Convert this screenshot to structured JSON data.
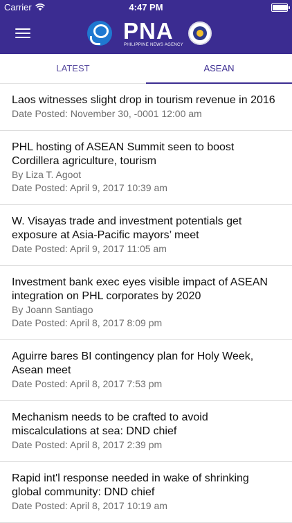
{
  "status_bar": {
    "carrier": "Carrier",
    "time": "4:47 PM",
    "battery_level": 1.0
  },
  "header": {
    "menu_icon": "hamburger-menu-icon",
    "logo_text": "PNA",
    "logo_subtitle": "PHILIPPINE NEWS AGENCY",
    "colors": {
      "primary": "#3b2c91",
      "logo_blue": "#1f78d1"
    }
  },
  "tabs": [
    {
      "label": "LATEST",
      "active": false
    },
    {
      "label": "ASEAN",
      "active": true
    }
  ],
  "articles": [
    {
      "title": "Laos witnesses slight drop in tourism revenue in 2016",
      "author": "",
      "date": "Date Posted: November 30, -0001 12:00 am"
    },
    {
      "title": "PHL hosting of ASEAN Summit seen to boost Cordillera agriculture, tourism",
      "author": "By Liza T. Agoot",
      "date": "Date Posted: April 9, 2017 10:39 am"
    },
    {
      "title": "W. Visayas trade and investment potentials get exposure at Asia-Pacific mayors’ meet",
      "author": "",
      "date": "Date Posted: April 9, 2017 11:05 am"
    },
    {
      "title": "Investment bank exec eyes visible impact of ASEAN integration on PHL corporates by 2020",
      "author": "By Joann Santiago",
      "date": "Date Posted: April 8, 2017 8:09 pm"
    },
    {
      "title": "Aguirre bares BI contingency plan for Holy Week, Asean meet",
      "author": "",
      "date": "Date Posted: April 8, 2017 7:53 pm"
    },
    {
      "title": "Mechanism needs to be crafted to avoid miscalculations at sea: DND chief",
      "author": "",
      "date": "Date Posted: April 8, 2017 2:39 pm"
    },
    {
      "title": "Rapid int'l response needed in wake of shrinking global community: DND chief",
      "author": "",
      "date": "Date Posted: April 8, 2017 10:19 am"
    }
  ]
}
